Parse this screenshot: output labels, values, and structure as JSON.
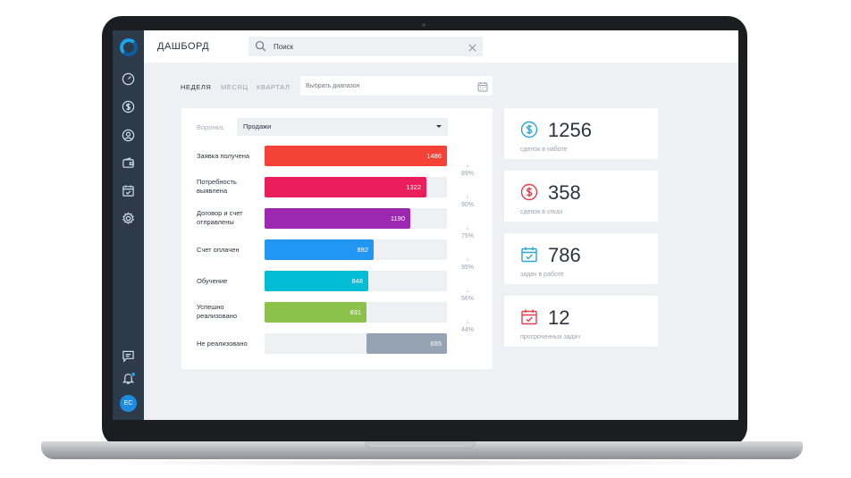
{
  "header": {
    "title": "ДАШБОРД",
    "search_placeholder": "Поиск"
  },
  "period_tabs": [
    {
      "label": "НЕДЕЛЯ",
      "active": true
    },
    {
      "label": "МЕСЯЦ",
      "active": false
    },
    {
      "label": "КВАРТАЛ",
      "active": false
    }
  ],
  "range_placeholder": "Выбрать диапазон",
  "sidebar": {
    "icons": [
      "speedometer-icon",
      "dollar-icon",
      "user-icon",
      "wallet-icon",
      "calendar-check-icon",
      "gear-icon"
    ],
    "bottom_icons": [
      "chat-icon",
      "bell-icon"
    ],
    "avatar_initials": "ЕС"
  },
  "funnel": {
    "label": "Воронка:",
    "selected": "Продажи",
    "max_value": 1486,
    "stages": [
      {
        "name": "Заявка получена",
        "value": 1486,
        "color": "#f44336",
        "align": "left"
      },
      {
        "name": "Потребность выявлена",
        "value": 1322,
        "color": "#e91e5a",
        "align": "left"
      },
      {
        "name": "Договор и счет отправлены",
        "value": 1190,
        "color": "#9c27b0",
        "align": "left"
      },
      {
        "name": "Счет оплачен",
        "value": 892,
        "color": "#2196f3",
        "align": "left"
      },
      {
        "name": "Обучение",
        "value": 848,
        "color": "#00bcd4",
        "align": "left"
      },
      {
        "name": "Успешно реализовано",
        "value": 831,
        "color": "#8bc34a",
        "align": "left"
      },
      {
        "name": "Не реализовано",
        "value": 655,
        "color": "#95a3b3",
        "align": "right"
      }
    ],
    "conversions": [
      "89%",
      "90%",
      "75%",
      "95%",
      "56%",
      "44%"
    ],
    "arrow": "↓"
  },
  "stats": [
    {
      "value": "1256",
      "caption": "сделок в наботе",
      "icon": "dollar-circle-icon",
      "color": "#2aa6d6"
    },
    {
      "value": "358",
      "caption": "сделок в отказ",
      "icon": "dollar-circle-icon",
      "color": "#e53e4f"
    },
    {
      "value": "786",
      "caption": "задач в работе",
      "icon": "calendar-check-icon",
      "color": "#2aa6d6"
    },
    {
      "value": "12",
      "caption": "просроченных задач",
      "icon": "calendar-check-icon",
      "color": "#e53e4f"
    }
  ]
}
